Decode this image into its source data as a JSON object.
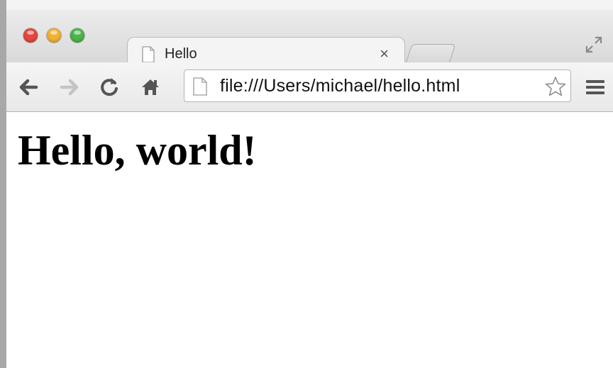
{
  "window": {
    "traffic_lights": [
      {
        "name": "close",
        "color": "#e2463f"
      },
      {
        "name": "minimize",
        "color": "#f1b230"
      },
      {
        "name": "zoom",
        "color": "#4ab44a"
      }
    ],
    "fullscreen_icon": "fullscreen-arrows-icon"
  },
  "tabs": [
    {
      "label": "Hello",
      "icon": "page-icon",
      "close_label": "×",
      "active": true
    }
  ],
  "toolbar": {
    "back_icon": "back-arrow-icon",
    "forward_icon": "forward-arrow-icon",
    "reload_icon": "reload-icon",
    "home_icon": "home-icon",
    "menu_icon": "hamburger-menu-icon"
  },
  "address_bar": {
    "value": "file:///Users/michael/hello.html",
    "page_icon": "page-icon",
    "bookmark_icon": "star-icon"
  },
  "page": {
    "heading": "Hello, world!"
  },
  "colors": {
    "forward_disabled": "#c4c4c4",
    "toolbar_icon": "#555555"
  }
}
